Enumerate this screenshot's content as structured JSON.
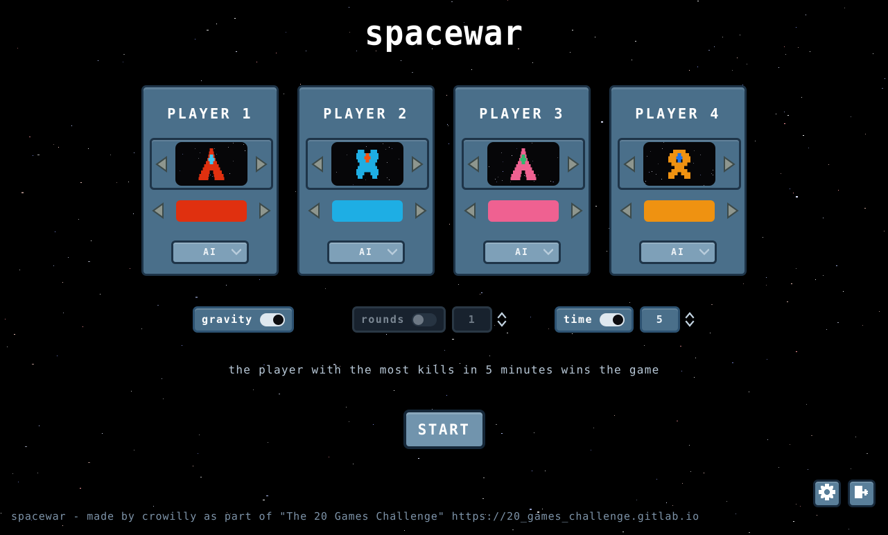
{
  "app": {
    "title": "spacewar",
    "background_color": "#000000"
  },
  "players": [
    {
      "title": "PLAYER 1",
      "ship_shape": "arrow",
      "ship_color": "#e0300f",
      "cockpit_color": "#3fc6f0",
      "swatch_color": "#e0300f",
      "type": "AI",
      "prev_icon": "left-arrow-icon",
      "next_icon": "right-arrow-icon",
      "chevron_icon": "chevron-down-icon"
    },
    {
      "title": "PLAYER 2",
      "ship_shape": "blob",
      "ship_color": "#1eaee4",
      "cockpit_color": "#f4510f",
      "swatch_color": "#1eaee4",
      "type": "AI",
      "prev_icon": "left-arrow-icon",
      "next_icon": "right-arrow-icon",
      "chevron_icon": "chevron-down-icon"
    },
    {
      "title": "PLAYER 3",
      "ship_shape": "arrow",
      "ship_color": "#ef6191",
      "cockpit_color": "#2eb86e",
      "swatch_color": "#ef6191",
      "type": "AI",
      "prev_icon": "left-arrow-icon",
      "next_icon": "right-arrow-icon",
      "chevron_icon": "chevron-down-icon"
    },
    {
      "title": "PLAYER 4",
      "ship_shape": "cross",
      "ship_color": "#ef9211",
      "cockpit_color": "#1f73e8",
      "swatch_color": "#ef9211",
      "type": "AI",
      "prev_icon": "left-arrow-icon",
      "next_icon": "right-arrow-icon",
      "chevron_icon": "chevron-down-icon"
    }
  ],
  "settings": {
    "gravity": {
      "label": "gravity",
      "enabled": true,
      "state": "on"
    },
    "rounds": {
      "label": "rounds",
      "enabled": false,
      "state": "off",
      "value": "1"
    },
    "time": {
      "label": "time",
      "enabled": true,
      "state": "on",
      "value": "5"
    },
    "spinner_icon": "up-down-stepper-icon"
  },
  "description": "the player with the most kills in 5 minutes wins the game",
  "start_button": {
    "label": "START"
  },
  "corner_icons": [
    {
      "name": "gear-icon",
      "label": "settings"
    },
    {
      "name": "exit-icon",
      "label": "quit"
    }
  ],
  "footer": "spacewar - made by crowilly as part of \"The 20 Games Challenge\" https://20_games_challenge.gitlab.io"
}
